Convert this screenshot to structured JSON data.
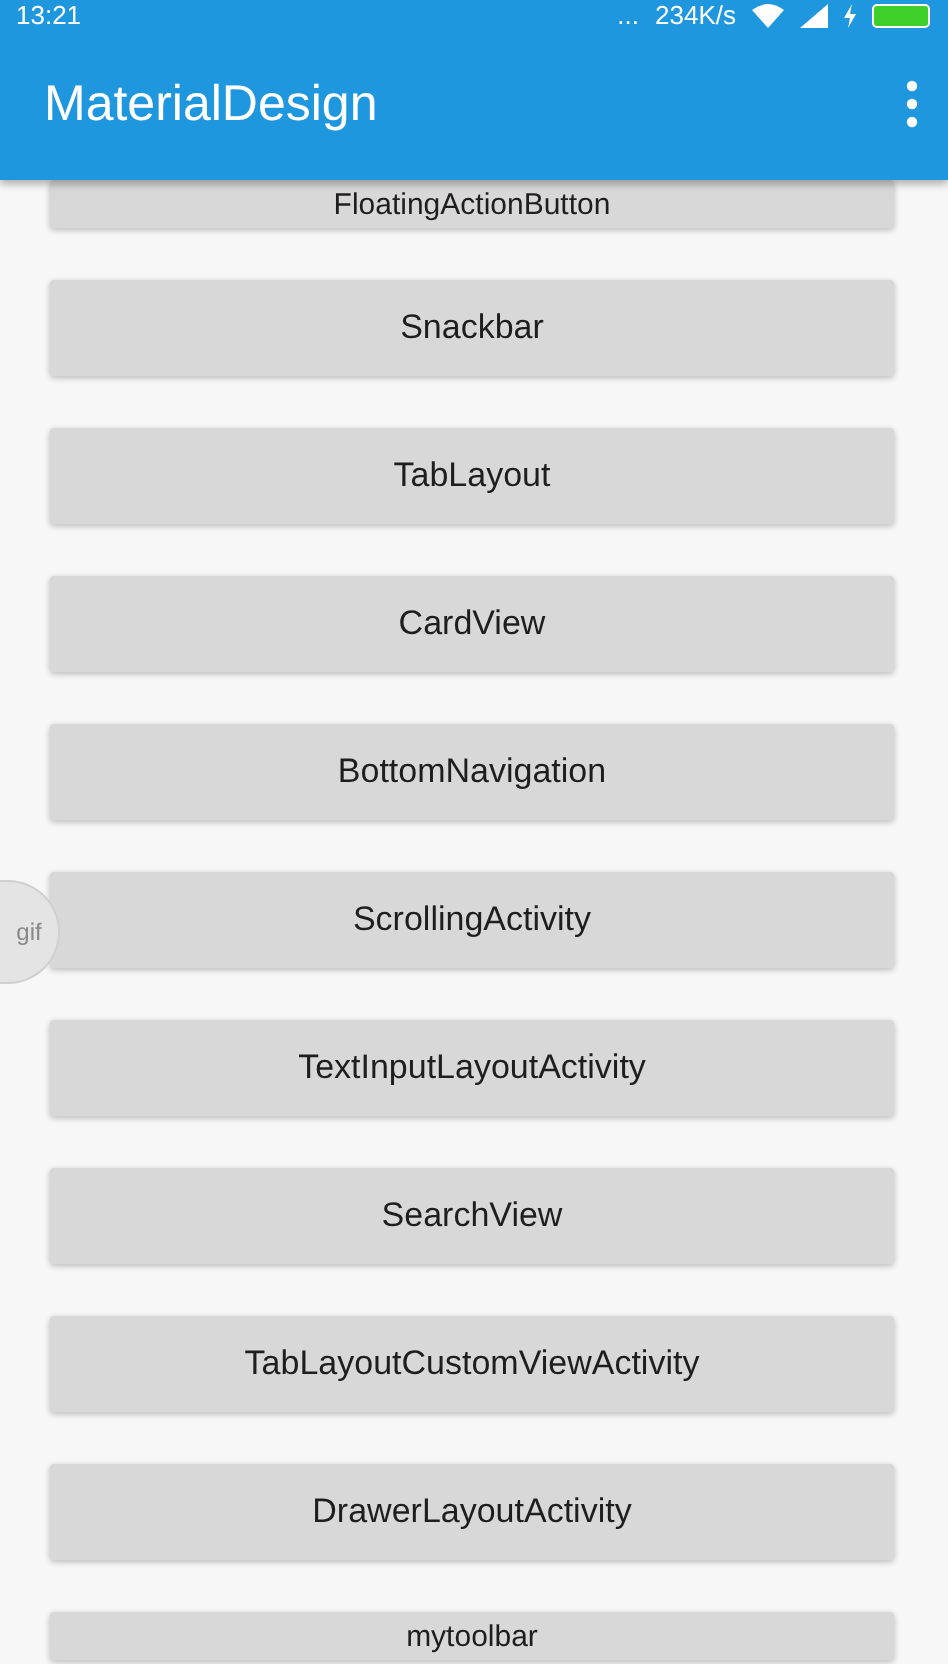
{
  "status_bar": {
    "time": "13:21",
    "more": "...",
    "speed": "234K/s"
  },
  "app_bar": {
    "title": "MaterialDesign"
  },
  "buttons": [
    {
      "label": "FloatingActionButton",
      "kind": "clipped"
    },
    {
      "label": "Snackbar"
    },
    {
      "label": "TabLayout"
    },
    {
      "label": "CardView"
    },
    {
      "label": "BottomNavigation"
    },
    {
      "label": "ScrollingActivity"
    },
    {
      "label": "TextInputLayoutActivity"
    },
    {
      "label": "SearchView"
    },
    {
      "label": "TabLayoutCustomViewActivity"
    },
    {
      "label": "DrawerLayoutActivity"
    },
    {
      "label": "mytoolbar",
      "kind": "clipped"
    }
  ],
  "floating_tab": {
    "label": "gif"
  }
}
